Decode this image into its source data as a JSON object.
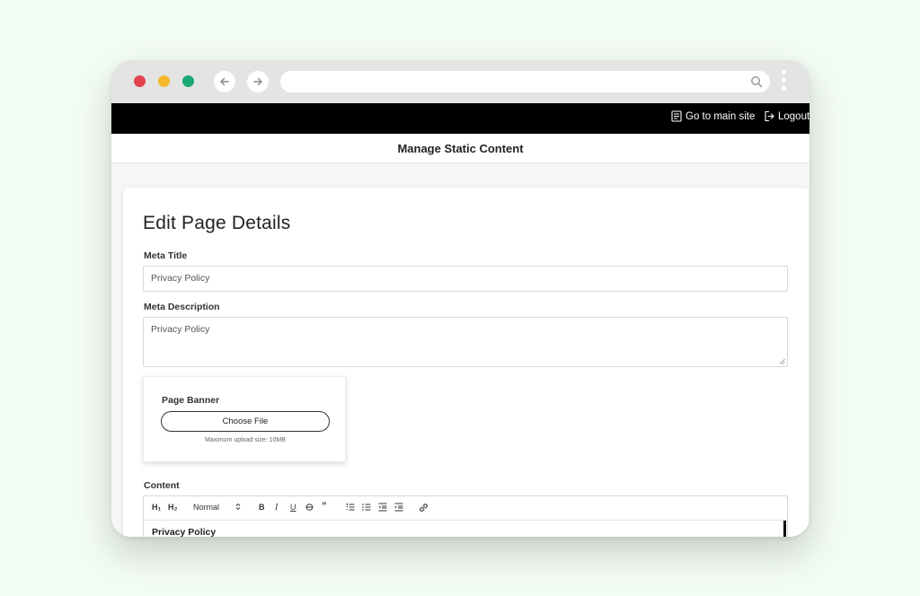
{
  "topbar": {
    "main_site_label": "Go to main site",
    "logout_label": "Logout"
  },
  "page_header": {
    "title": "Manage Static Content"
  },
  "form": {
    "title": "Edit Page Details",
    "meta_title_label": "Meta Title",
    "meta_title_value": "Privacy Policy",
    "meta_description_label": "Meta Description",
    "meta_description_value": "Privacy Policy",
    "banner": {
      "label": "Page Banner",
      "button_label": "Choose File",
      "hint": "Maximum upload size: 10MB"
    },
    "content_label": "Content",
    "toolbar": {
      "h1": "H₁",
      "h2": "H₂",
      "format_select": "Normal",
      "bold": "B",
      "italic": "I",
      "underline": "U",
      "quote": "”"
    },
    "content_value": "Privacy Policy"
  },
  "colors": {
    "background": "#f3fcf3",
    "topbar": "#000000",
    "close_dot": "#e3424f",
    "minimize_dot": "#f6b72a",
    "maximize_dot": "#1aa874"
  }
}
